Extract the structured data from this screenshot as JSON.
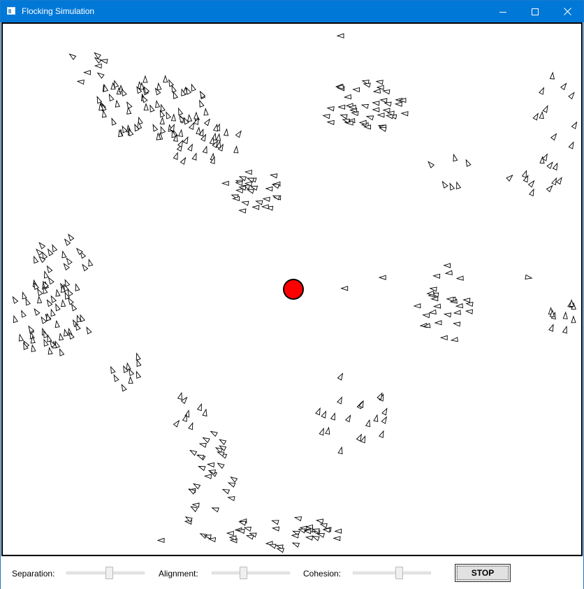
{
  "window": {
    "title": "Flocking Simulation",
    "icon": "app-window-icon",
    "controls": [
      "minimize-icon",
      "maximize-icon",
      "close-icon"
    ],
    "accent_color": "#0078d7"
  },
  "simulation": {
    "predator_color": "#ff0000",
    "boid_fill": "#ffffff",
    "boid_stroke": "#000000"
  },
  "controls": {
    "separation": {
      "label": "Separation:",
      "value": 0.55
    },
    "alignment": {
      "label": "Alignment:",
      "value": 0.4
    },
    "cohesion": {
      "label": "Cohesion:",
      "value": 0.6
    },
    "stop_label": "STOP"
  }
}
